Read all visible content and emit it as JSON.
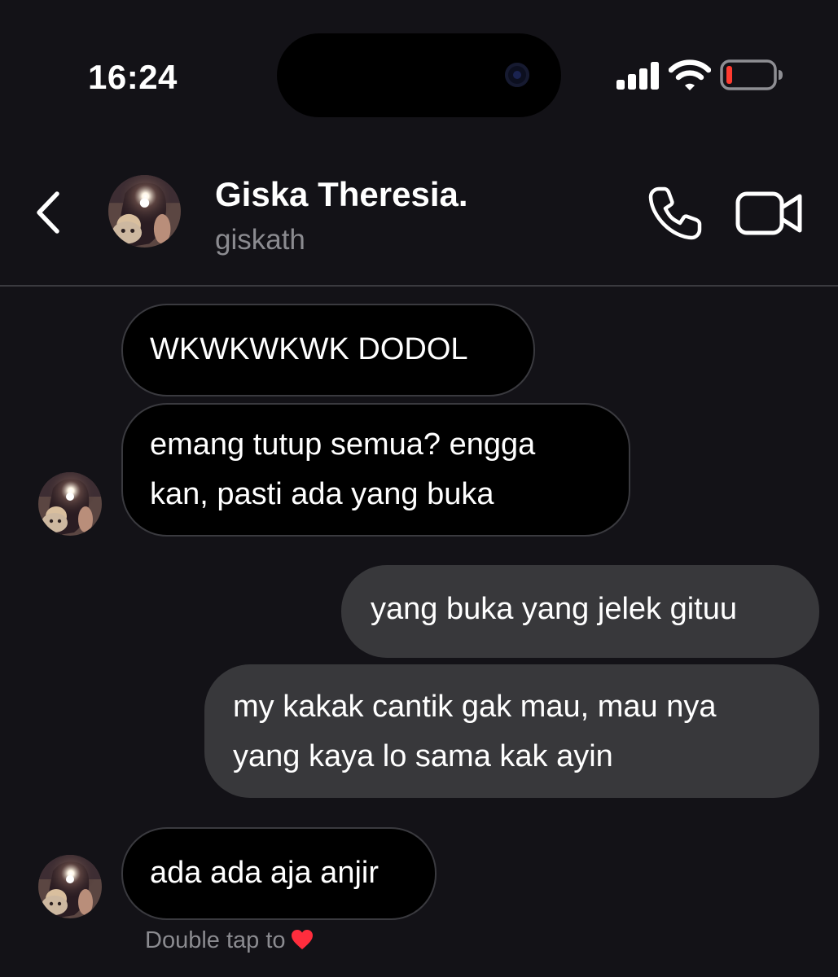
{
  "status_bar": {
    "time": "16:24"
  },
  "header": {
    "contact_name": "Giska Theresia.",
    "username": "giskath",
    "icons": {
      "back": "chevron-left-icon",
      "call": "phone-icon",
      "video": "video-camera-icon"
    }
  },
  "messages": [
    {
      "sender": "contact",
      "lines": [
        "WKWKWKWK DODOL"
      ]
    },
    {
      "sender": "contact",
      "lines": [
        "emang tutup semua? engga",
        "kan, pasti ada yang buka"
      ]
    },
    {
      "sender": "me",
      "lines": [
        "yang buka yang jelek gituu"
      ]
    },
    {
      "sender": "me",
      "lines": [
        "my kakak cantik gak mau, mau nya",
        "yang kaya lo sama kak ayin"
      ]
    },
    {
      "sender": "contact",
      "lines": [
        "ada ada aja anjir"
      ]
    }
  ],
  "reaction_hint": {
    "text": "Double tap to",
    "icon": "heart-icon"
  },
  "colors": {
    "background": "#131217",
    "incoming_bubble": "#000000",
    "incoming_border": "#3a3a3f",
    "outgoing_bubble": "#38383b",
    "secondary_text": "#8b8b90",
    "battery_low": "#ff3b30",
    "heart": "#ff2d3d"
  }
}
